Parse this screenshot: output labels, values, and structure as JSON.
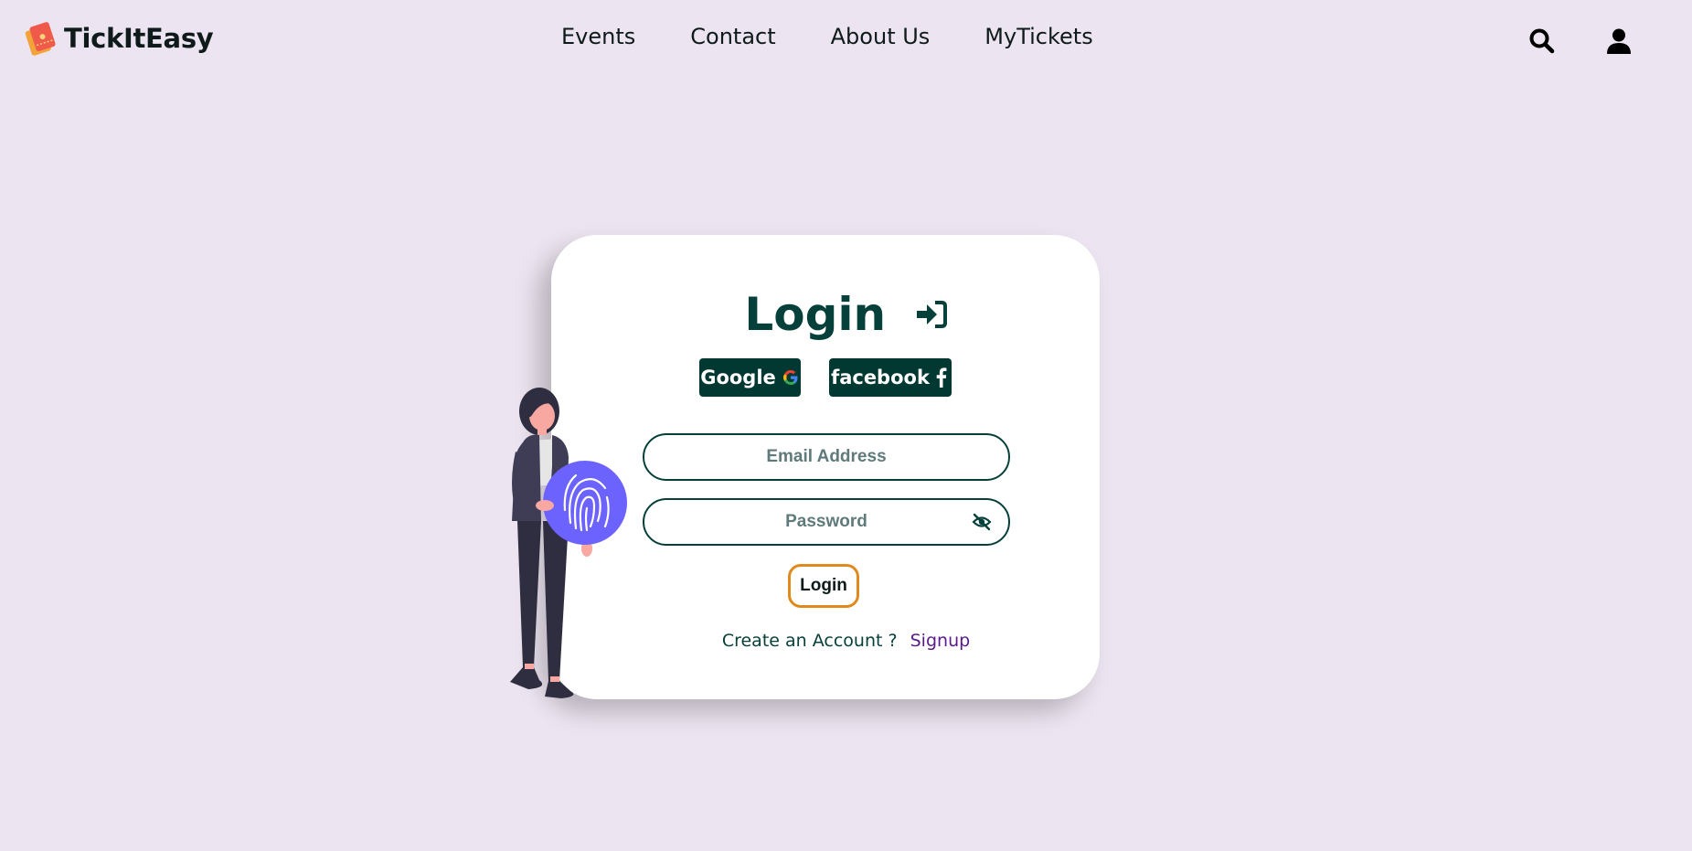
{
  "brand": {
    "name": "TickItEasy",
    "logo_icon": "tickets-icon"
  },
  "nav": {
    "links": [
      {
        "label": "Events"
      },
      {
        "label": "Contact"
      },
      {
        "label": "About Us"
      },
      {
        "label": "MyTickets"
      }
    ],
    "search_icon": "search-icon",
    "user_icon": "user-icon"
  },
  "login": {
    "title": "Login",
    "google_label": "Google",
    "facebook_label": "facebook",
    "email_placeholder": "Email Address",
    "password_placeholder": "Password",
    "submit_label": "Login",
    "create_account_text": "Create an Account ?",
    "signup_label": "Signup"
  },
  "colors": {
    "background": "#ece4f0",
    "primary_dark": "#023832",
    "accent_orange": "#e08a1e",
    "signup_purple": "#5a1a8a",
    "fingerprint_purple": "#6c63ff"
  }
}
